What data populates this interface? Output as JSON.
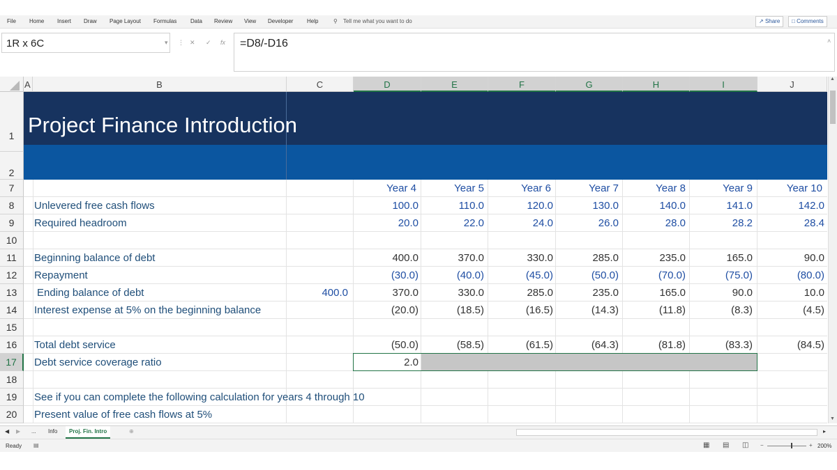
{
  "ribbon": {
    "tabs": [
      "File",
      "Home",
      "Insert",
      "Draw",
      "Page Layout",
      "Formulas",
      "Data",
      "Review",
      "View",
      "Developer",
      "Help"
    ],
    "search": "Tell me what you want to do",
    "share": "Share",
    "comments": "Comments"
  },
  "formula_bar": {
    "name_box": "1R x 6C",
    "formula": "=D8/-D16"
  },
  "columns": [
    "A",
    "B",
    "C",
    "D",
    "E",
    "F",
    "G",
    "H",
    "I",
    "J"
  ],
  "rows": [
    "1",
    "2",
    "7",
    "8",
    "9",
    "10",
    "11",
    "12",
    "13",
    "14",
    "15",
    "16",
    "17",
    "18",
    "19",
    "20"
  ],
  "title": "Project Finance Introduction",
  "years": [
    "Year 4",
    "Year 5",
    "Year 6",
    "Year 7",
    "Year 8",
    "Year 9",
    "Year 10"
  ],
  "lines": [
    {
      "label": "Unlevered free cash flows",
      "c": "",
      "values": [
        "100.0",
        "110.0",
        "120.0",
        "130.0",
        "140.0",
        "141.0",
        "142.0"
      ],
      "blue": true
    },
    {
      "label": "Required headroom",
      "c": "",
      "values": [
        "20.0",
        "22.0",
        "24.0",
        "26.0",
        "28.0",
        "28.2",
        "28.4"
      ],
      "blue": true
    },
    {
      "label": "",
      "c": "",
      "values": [
        "",
        "",
        "",
        "",
        "",
        "",
        ""
      ]
    },
    {
      "label": "Beginning balance of debt",
      "c": "",
      "values": [
        "400.0",
        "370.0",
        "330.0",
        "285.0",
        "235.0",
        "165.0",
        "90.0"
      ]
    },
    {
      "label": "Repayment",
      "c": "",
      "values": [
        "(30.0)",
        "(40.0)",
        "(45.0)",
        "(50.0)",
        "(70.0)",
        "(75.0)",
        "(80.0)"
      ],
      "blue": true
    },
    {
      "label": "Ending balance of debt",
      "c": "400.0",
      "values": [
        "370.0",
        "330.0",
        "285.0",
        "235.0",
        "165.0",
        "90.0",
        "10.0"
      ]
    },
    {
      "label": "Interest expense at 5% on the beginning balance",
      "c": "",
      "values": [
        "(20.0)",
        "(18.5)",
        "(16.5)",
        "(14.3)",
        "(11.8)",
        "(8.3)",
        "(4.5)"
      ]
    },
    {
      "label": "",
      "c": "",
      "values": [
        "",
        "",
        "",
        "",
        "",
        "",
        ""
      ]
    },
    {
      "label": "Total debt service",
      "c": "",
      "values": [
        "(50.0)",
        "(58.5)",
        "(61.5)",
        "(64.3)",
        "(81.8)",
        "(83.3)",
        "(84.5)"
      ]
    },
    {
      "label": "Debt service coverage ratio",
      "c": "",
      "values": [
        "2.0",
        "",
        "",
        "",
        "",
        "",
        ""
      ]
    },
    {
      "label": "",
      "c": "",
      "values": [
        "",
        "",
        "",
        "",
        "",
        "",
        ""
      ]
    },
    {
      "label": "See if you can complete the following calculation for years 4 through 10",
      "c": "",
      "values": [
        "",
        "",
        "",
        "",
        "",
        "",
        ""
      ]
    },
    {
      "label": "Present value of free cash flows at 5%",
      "c": "",
      "values": [
        "",
        "",
        "",
        "",
        "",
        "",
        ""
      ]
    }
  ],
  "sheets": [
    "...",
    "Info",
    "Proj. Fin. Intro"
  ],
  "status": {
    "ready": "Ready",
    "zoom": "200%"
  }
}
